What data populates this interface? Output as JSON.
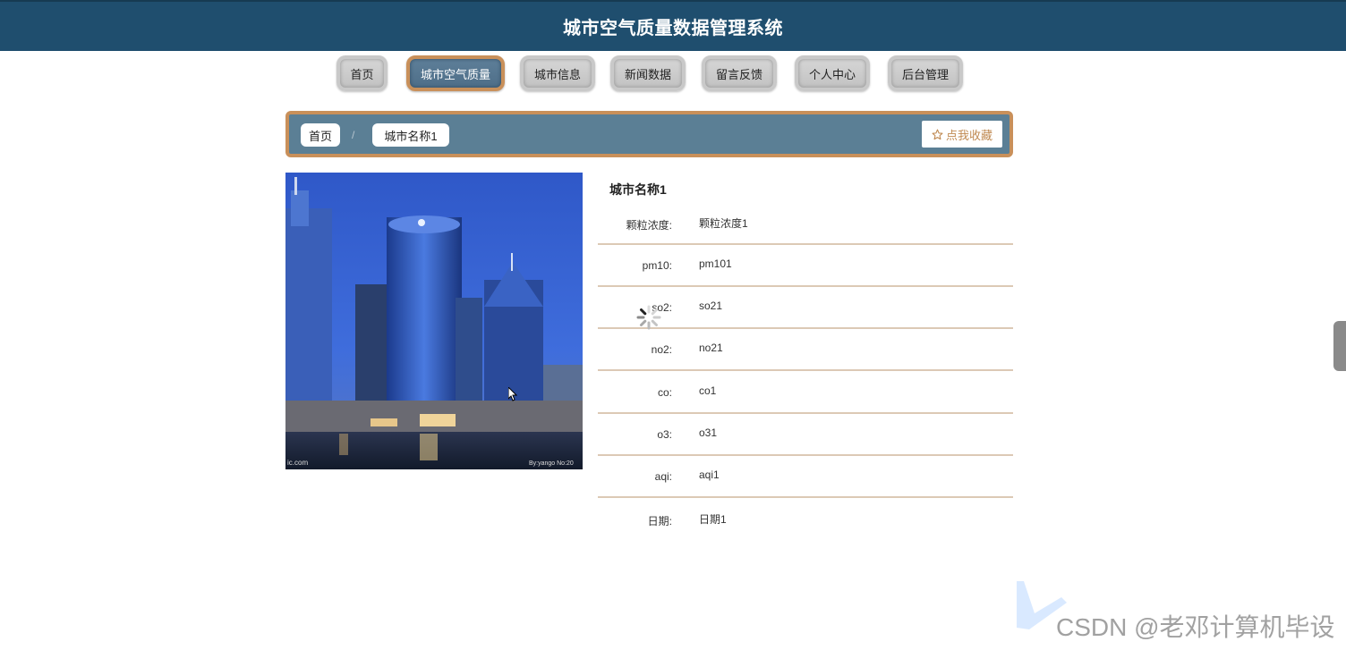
{
  "header": {
    "title": "城市空气质量数据管理系统"
  },
  "nav": {
    "items": [
      {
        "label": "首页"
      },
      {
        "label": "城市空气质量"
      },
      {
        "label": "城市信息"
      },
      {
        "label": "新闻数据"
      },
      {
        "label": "留言反馈"
      },
      {
        "label": "个人中心"
      },
      {
        "label": "后台管理"
      }
    ],
    "active_index": 1
  },
  "breadcrumb": {
    "home": "首页",
    "separator": "/",
    "current": "城市名称1"
  },
  "favorite": {
    "icon": "star-outline-icon",
    "label": "点我收藏"
  },
  "detail": {
    "title": "城市名称1",
    "fields": [
      {
        "label": "颗粒浓度:",
        "value": "颗粒浓度1"
      },
      {
        "label": "pm10:",
        "value": "pm101"
      },
      {
        "label": "so2:",
        "value": "so21"
      },
      {
        "label": "no2:",
        "value": "no21"
      },
      {
        "label": "co:",
        "value": "co1"
      },
      {
        "label": "o3:",
        "value": "o31"
      },
      {
        "label": "aqi:",
        "value": "aqi1"
      },
      {
        "label": "日期:",
        "value": "日期1"
      }
    ]
  },
  "photo": {
    "left_caption": "ic.com",
    "right_caption": "By:yango No:20"
  },
  "watermark": {
    "text": "CSDN @老邓计算机毕设"
  },
  "colors": {
    "header_bg": "#1f4e6e",
    "accent_border": "#c9905a",
    "crumb_bar_bg": "#5b7f95",
    "active_nav_bg": "#5e7f99"
  }
}
